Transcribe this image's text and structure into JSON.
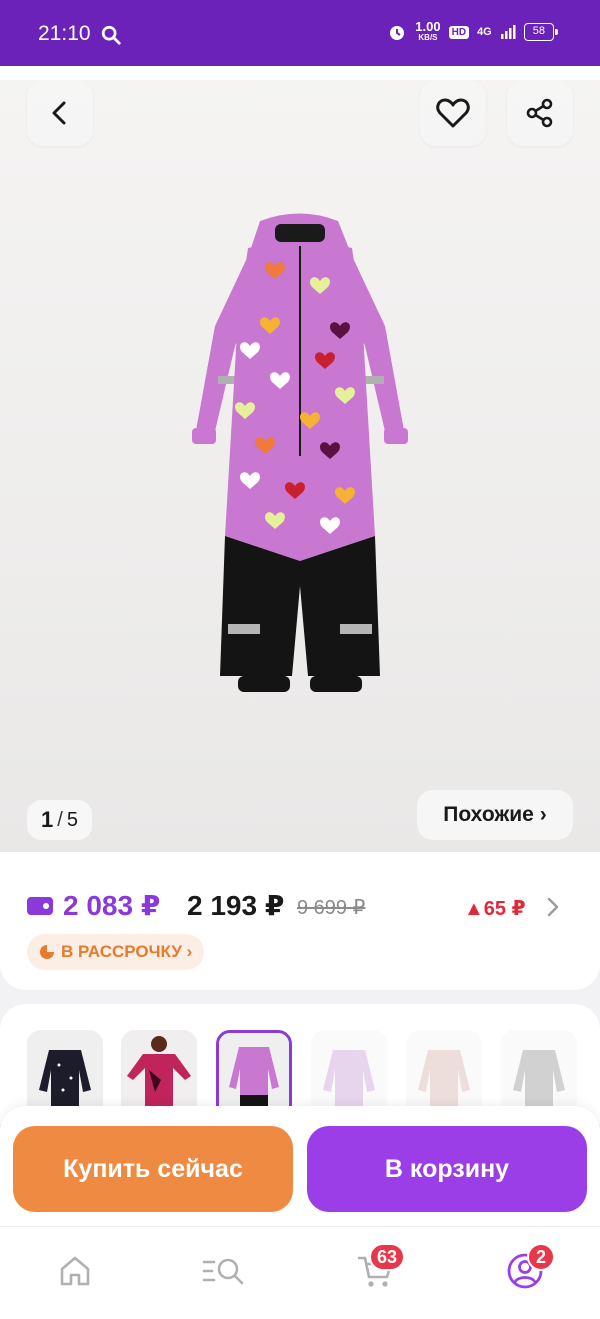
{
  "status_bar": {
    "time": "21:10",
    "speed_value": "1.00",
    "speed_unit": "KB/S",
    "hd_label": "HD",
    "network": "4G",
    "battery": "58"
  },
  "gallery": {
    "current": "1",
    "separator": "/",
    "total": "5",
    "similar_label": "Похожие ›",
    "product_colors": {
      "body": "#c878d0",
      "pants": "#141414"
    }
  },
  "price": {
    "wallet_price": "2 083 ₽",
    "regular_price": "2 193 ₽",
    "old_price": "9 699 ₽",
    "diff": "▲65 ₽",
    "installment_label": "В РАССРОЧКУ ›"
  },
  "variants": [
    {
      "name": "dark-stars"
    },
    {
      "name": "pink-camo"
    },
    {
      "name": "lilac-hearts"
    },
    {
      "name": "lilac-print"
    },
    {
      "name": "beige-print"
    },
    {
      "name": "grey-print"
    }
  ],
  "actions": {
    "buy_now": "Купить сейчас",
    "add_to_cart": "В корзину"
  },
  "bottom_nav": {
    "cart_badge": "63",
    "profile_badge": "2"
  },
  "colors": {
    "brand_purple": "#6a22b8",
    "accent_purple": "#9b3ee8",
    "accent_orange": "#ef8a42",
    "badge_red": "#e8374a"
  }
}
